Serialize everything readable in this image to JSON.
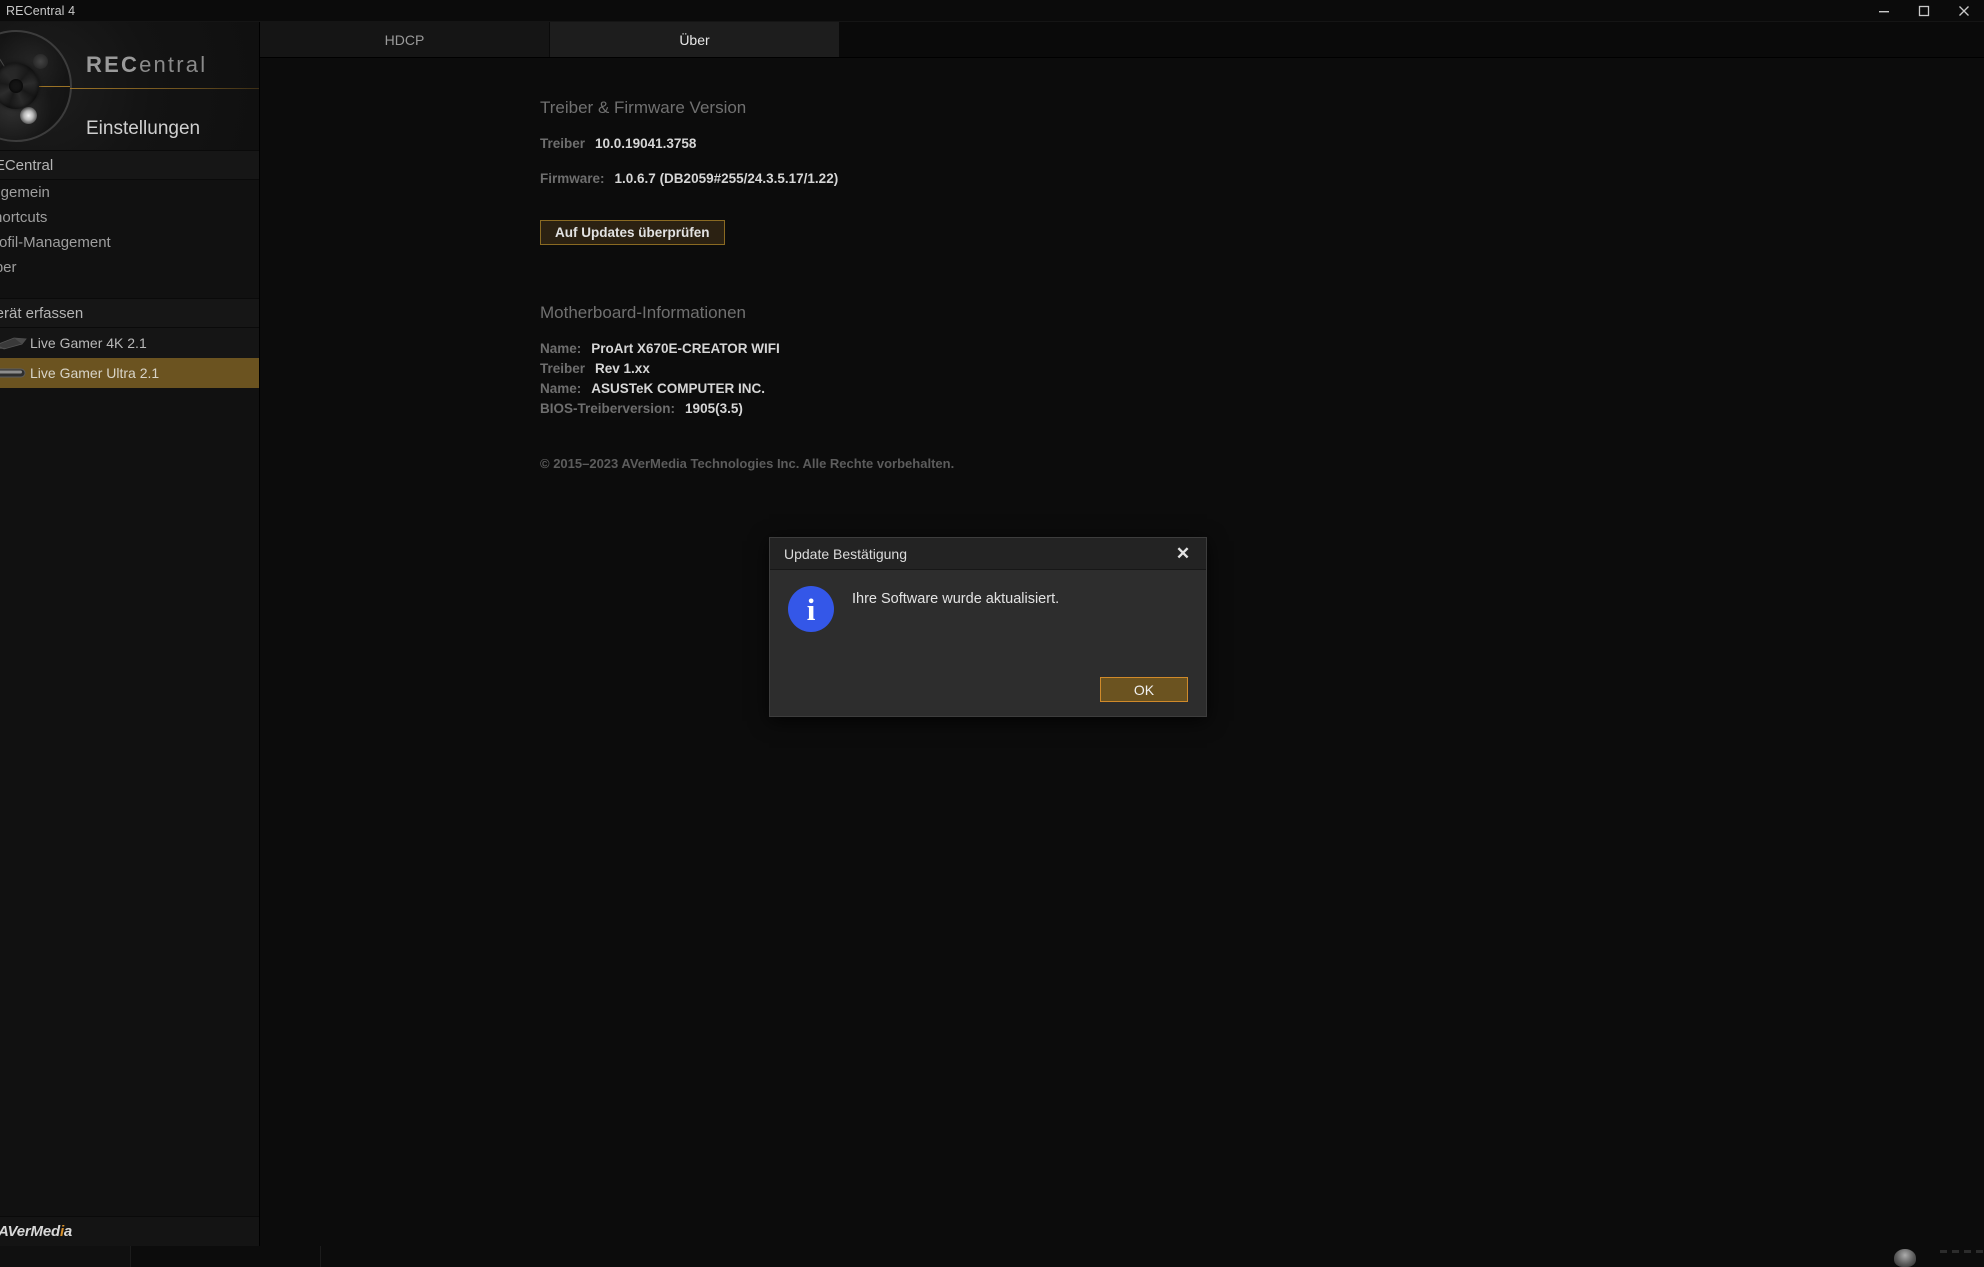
{
  "window": {
    "title": "RECentral 4",
    "controls": {
      "minimize": "minimize-icon",
      "maximize": "maximize-icon",
      "close": "close-icon"
    }
  },
  "sidebar": {
    "brand": {
      "word_rec": "REC",
      "word_entral": "entral",
      "subtitle": "Einstellungen",
      "dial_icon": "aperture-dial-icon",
      "folder_icon": "folder-icon"
    },
    "groups": [
      {
        "header": "RECentral",
        "items": [
          {
            "label": "Allgemein"
          },
          {
            "label": "Shortcuts"
          },
          {
            "label": "Profil-Management"
          },
          {
            "label": "Über"
          }
        ]
      }
    ],
    "devices_header": "Gerät erfassen",
    "devices": [
      {
        "label": "Live Gamer 4K 2.1",
        "icon": "capture-card-icon",
        "active": false
      },
      {
        "label": "Live Gamer Ultra 2.1",
        "icon": "capture-box-icon",
        "active": true
      }
    ],
    "footer_logo": {
      "part1": "AVerMed",
      "dot": "i",
      "part2": "a"
    }
  },
  "tabs": [
    {
      "label": "HDCP",
      "active": false
    },
    {
      "label": "Über",
      "active": true
    }
  ],
  "main": {
    "firmware_section": {
      "title": "Treiber & Firmware Version",
      "rows": [
        {
          "key": "Treiber",
          "value": "10.0.19041.3758"
        },
        {
          "key": "Firmware:",
          "value": "1.0.6.7 (DB2059#255/24.3.5.17/1.22)"
        }
      ],
      "check_updates_label": "Auf Updates überprüfen"
    },
    "motherboard_section": {
      "title": "Motherboard-Informationen",
      "rows": [
        {
          "key": "Name:",
          "value": "ProArt X670E-CREATOR WIFI"
        },
        {
          "key": "Treiber",
          "value": "Rev 1.xx"
        },
        {
          "key": "Name:",
          "value": "ASUSTeK COMPUTER INC."
        },
        {
          "key": "BIOS-Treiberversion:",
          "value": "1905(3.5)"
        }
      ]
    },
    "copyright": "© 2015–2023 AVerMedia Technologies Inc. Alle Rechte vorbehalten."
  },
  "dialog": {
    "title": "Update Bestätigung",
    "close_icon": "close-icon",
    "info_icon": "info-icon",
    "info_glyph": "i",
    "message": "Ihre Software wurde aktualisiert.",
    "ok_label": "OK"
  },
  "colors": {
    "accent_amber": "#d08a2a",
    "accent_amber_fill": "#6b5320",
    "info_blue": "#3457e8",
    "window_bg": "#0d0d0d",
    "sidebar_bg": "#111111"
  }
}
